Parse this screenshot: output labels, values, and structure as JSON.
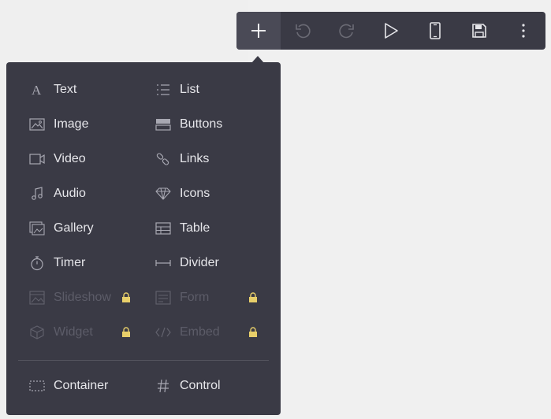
{
  "toolbar": {
    "buttons": [
      {
        "name": "add",
        "icon": "plus-icon",
        "active": true
      },
      {
        "name": "undo",
        "icon": "undo-icon",
        "disabled": true
      },
      {
        "name": "redo",
        "icon": "redo-icon",
        "disabled": true
      },
      {
        "name": "preview",
        "icon": "play-icon"
      },
      {
        "name": "mobile",
        "icon": "mobile-icon"
      },
      {
        "name": "save",
        "icon": "save-icon"
      },
      {
        "name": "more",
        "icon": "more-vertical-icon"
      }
    ]
  },
  "panel": {
    "items": [
      {
        "label": "Text",
        "icon": "text-icon"
      },
      {
        "label": "List",
        "icon": "list-icon"
      },
      {
        "label": "Image",
        "icon": "image-icon"
      },
      {
        "label": "Buttons",
        "icon": "buttons-icon"
      },
      {
        "label": "Video",
        "icon": "video-icon"
      },
      {
        "label": "Links",
        "icon": "link-icon"
      },
      {
        "label": "Audio",
        "icon": "music-icon"
      },
      {
        "label": "Icons",
        "icon": "diamond-icon"
      },
      {
        "label": "Gallery",
        "icon": "gallery-icon"
      },
      {
        "label": "Table",
        "icon": "table-icon"
      },
      {
        "label": "Timer",
        "icon": "stopwatch-icon"
      },
      {
        "label": "Divider",
        "icon": "divider-icon"
      },
      {
        "label": "Slideshow",
        "icon": "slideshow-icon",
        "locked": true
      },
      {
        "label": "Form",
        "icon": "form-icon",
        "locked": true
      },
      {
        "label": "Widget",
        "icon": "cube-icon",
        "locked": true
      },
      {
        "label": "Embed",
        "icon": "code-icon",
        "locked": true
      }
    ],
    "footer_items": [
      {
        "label": "Container",
        "icon": "container-icon"
      },
      {
        "label": "Control",
        "icon": "hash-icon"
      }
    ],
    "lock_color": "#e8cf6a"
  }
}
